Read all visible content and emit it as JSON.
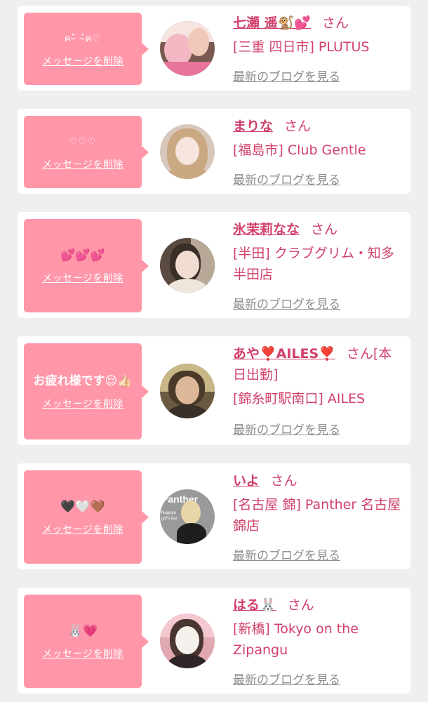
{
  "items": [
    {
      "message": "ฅ˘̴̀ ˘̴́ฅ♡",
      "delete_label": "メッセージを削除",
      "name": "七瀬 遥🐒💕",
      "suffix": "さん",
      "shop": "[三重 四日市] PLUTUS",
      "blog_label": "最新のブログを見る"
    },
    {
      "message": "♡♡♡",
      "delete_label": "メッセージを削除",
      "name": "まりな",
      "suffix": "さん",
      "shop": "[福島市] Club Gentle",
      "blog_label": "最新のブログを見る"
    },
    {
      "message": "💕💕💕",
      "delete_label": "メッセージを削除",
      "name": "氷茉莉なな",
      "suffix": "さん",
      "shop": "[半田] クラブグリム・知多半田店",
      "blog_label": "最新のブログを見る"
    },
    {
      "message": "お疲れ様です😌👍🏻",
      "delete_label": "メッセージを削除",
      "name": "あや❣️AILES❣️",
      "suffix": "さん[本日出勤]",
      "shop": "[錦糸町駅南口] AILES",
      "blog_label": "最新のブログを見る"
    },
    {
      "message": "🖤🤍🤎",
      "delete_label": "メッセージを削除",
      "name": "いよ",
      "suffix": "さん",
      "shop": "[名古屋 錦] Panther 名古屋錦店",
      "blog_label": "最新のブログを見る",
      "avatar_text_1": "Panther",
      "avatar_text_2": "Nagoya girl's bar"
    },
    {
      "message": "🐰💗",
      "delete_label": "メッセージを削除",
      "name": "はる🐰",
      "suffix": "さん",
      "shop": "[新橋] Tokyo on the Zipangu",
      "blog_label": "最新のブログを見る"
    }
  ]
}
